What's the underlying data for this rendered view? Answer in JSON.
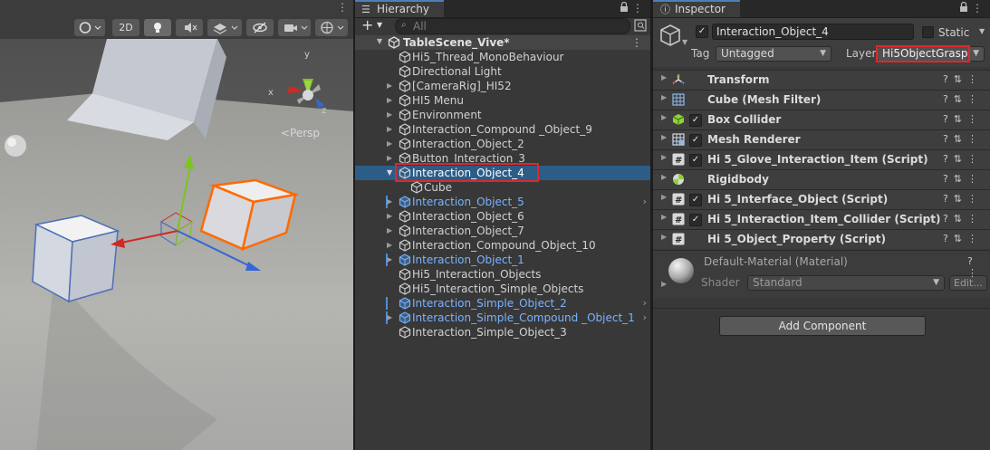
{
  "scene": {
    "toolbar": {
      "mode_2d": "2D"
    },
    "persp_label": "<Persp",
    "gizmo_axes": {
      "x": "x",
      "y": "y",
      "z": "z"
    }
  },
  "hierarchy": {
    "tab_title": "Hierarchy",
    "add_label": "+",
    "search_placeholder": "All",
    "scene_name": "TableScene_Vive*",
    "items": [
      {
        "label": "Hi5_Thread_MonoBehaviour",
        "prefab": false,
        "expandable": false,
        "marked": false,
        "indent": 1
      },
      {
        "label": "Directional Light",
        "prefab": false,
        "expandable": false,
        "marked": false,
        "indent": 1
      },
      {
        "label": "[CameraRig]_HI52",
        "prefab": false,
        "expandable": true,
        "marked": false,
        "indent": 1
      },
      {
        "label": "HI5 Menu",
        "prefab": false,
        "expandable": true,
        "marked": false,
        "indent": 1
      },
      {
        "label": "Environment",
        "prefab": false,
        "expandable": true,
        "marked": false,
        "indent": 1
      },
      {
        "label": "Interaction_Compound _Object_9",
        "prefab": false,
        "expandable": true,
        "marked": false,
        "indent": 1
      },
      {
        "label": "Interaction_Object_2",
        "prefab": false,
        "expandable": true,
        "marked": false,
        "indent": 1
      },
      {
        "label": "Button_Interaction_3",
        "prefab": false,
        "expandable": true,
        "marked": false,
        "indent": 1
      },
      {
        "label": "Interaction_Object_4",
        "prefab": false,
        "expandable": true,
        "marked": false,
        "indent": 1,
        "selected": true
      },
      {
        "label": "Cube",
        "prefab": false,
        "expandable": false,
        "marked": false,
        "indent": 2
      },
      {
        "label": "Interaction_Object_5",
        "prefab": true,
        "expandable": true,
        "marked": true,
        "indent": 1,
        "chevron": true
      },
      {
        "label": "Interaction_Object_6",
        "prefab": false,
        "expandable": true,
        "marked": false,
        "indent": 1
      },
      {
        "label": "Interaction_Object_7",
        "prefab": false,
        "expandable": true,
        "marked": false,
        "indent": 1
      },
      {
        "label": "Interaction_Compound_Object_10",
        "prefab": false,
        "expandable": true,
        "marked": false,
        "indent": 1
      },
      {
        "label": "Interaction_Object_1",
        "prefab": true,
        "expandable": true,
        "marked": true,
        "indent": 1
      },
      {
        "label": "Hi5_Interaction_Objects",
        "prefab": false,
        "expandable": false,
        "marked": false,
        "indent": 1
      },
      {
        "label": "Hi5_Interaction_Simple_Objects",
        "prefab": false,
        "expandable": false,
        "marked": false,
        "indent": 1
      },
      {
        "label": "Interaction_Simple_Object_2",
        "prefab": true,
        "expandable": false,
        "marked": true,
        "indent": 1,
        "chevron": true
      },
      {
        "label": "Interaction_Simple_Compound _Object_1",
        "prefab": true,
        "expandable": true,
        "marked": true,
        "indent": 1,
        "chevron": true
      },
      {
        "label": "Interaction_Simple_Object_3",
        "prefab": false,
        "expandable": false,
        "marked": false,
        "indent": 1
      }
    ]
  },
  "inspector": {
    "tab_title": "Inspector",
    "object_name": "Interaction_Object_4",
    "active": true,
    "static_label": "Static",
    "tag_label": "Tag",
    "tag_value": "Untagged",
    "layer_label": "Layer",
    "layer_value": "Hi5ObjectGrasp",
    "components": [
      {
        "name": "Transform",
        "icon": "transform-icon",
        "checkbox": false
      },
      {
        "name": "Cube (Mesh Filter)",
        "icon": "mesh-filter-icon",
        "checkbox": false
      },
      {
        "name": "Box Collider",
        "icon": "box-collider-icon",
        "checkbox": true
      },
      {
        "name": "Mesh Renderer",
        "icon": "mesh-renderer-icon",
        "checkbox": true
      },
      {
        "name": "Hi 5_Glove_Interaction_Item (Script)",
        "icon": "script-icon",
        "checkbox": true
      },
      {
        "name": "Rigidbody",
        "icon": "rigidbody-icon",
        "checkbox": false
      },
      {
        "name": "Hi 5_Interface_Object (Script)",
        "icon": "script-icon",
        "checkbox": true
      },
      {
        "name": "Hi 5_Interaction_Item_Collider (Script)",
        "icon": "script-icon",
        "checkbox": true
      },
      {
        "name": "Hi 5_Object_Property (Script)",
        "icon": "script-icon",
        "checkbox": false
      }
    ],
    "material_name": "Default-Material (Material)",
    "shader_label": "Shader",
    "shader_value": "Standard",
    "edit_label": "Edit...",
    "add_component_label": "Add Component"
  },
  "colors": {
    "selection": "#2c5d87",
    "highlight_red": "#e0262b",
    "prefab_blue": "#7ab4ff",
    "orange_outline": "#ff6a00"
  }
}
